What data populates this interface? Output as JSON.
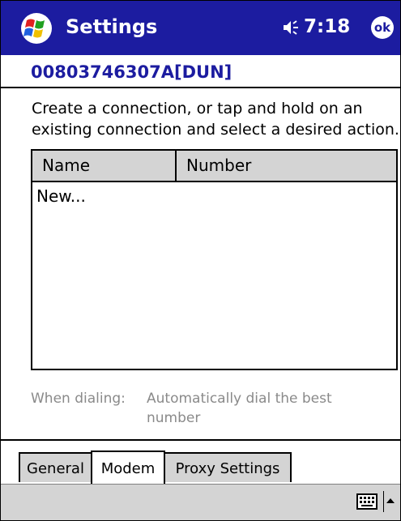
{
  "titlebar": {
    "title": "Settings",
    "time": "7:18",
    "ok_label": "ok",
    "bg_color": "#1c1ca0"
  },
  "device": {
    "name": "00803746307A[DUN]"
  },
  "instructions": "Create a connection, or tap and hold on an existing connection and select a desired action.",
  "listview": {
    "columns": [
      "Name",
      "Number"
    ],
    "rows": [
      "New..."
    ]
  },
  "dialing": {
    "label": "When dialing:",
    "value": "Automatically dial the best number"
  },
  "tabs": [
    {
      "label": "General",
      "selected": false
    },
    {
      "label": "Modem",
      "selected": true
    },
    {
      "label": "Proxy Settings",
      "selected": false
    }
  ],
  "icons": {
    "start": "windows-flag-icon",
    "volume": "speaker-icon",
    "keyboard": "keyboard-icon",
    "sip_menu": "up-arrow-icon"
  }
}
